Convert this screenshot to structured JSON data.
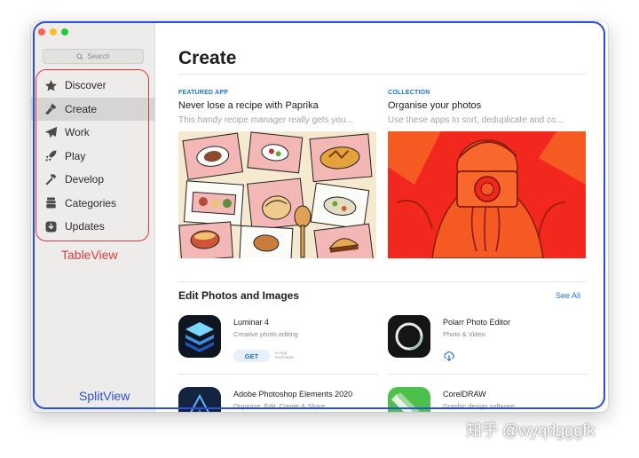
{
  "sidebar": {
    "search_placeholder": "Search",
    "items": [
      {
        "label": "Discover",
        "icon": "star-icon"
      },
      {
        "label": "Create",
        "icon": "brush-icon"
      },
      {
        "label": "Work",
        "icon": "paper-plane-icon"
      },
      {
        "label": "Play",
        "icon": "rocket-icon"
      },
      {
        "label": "Develop",
        "icon": "hammer-icon"
      },
      {
        "label": "Categories",
        "icon": "stack-icon"
      },
      {
        "label": "Updates",
        "icon": "download-icon"
      }
    ],
    "active": "Create"
  },
  "main": {
    "title": "Create",
    "features": [
      {
        "kicker": "FEATURED APP",
        "headline": "Never lose a recipe with Paprika",
        "sub": "This handy recipe manager really gets you..."
      },
      {
        "kicker": "COLLECTION",
        "headline": "Organise your photos",
        "sub": "Use these apps to sort, deduplicate and co..."
      }
    ],
    "section": {
      "title": "Edit Photos and Images",
      "see_all": "See All"
    },
    "apps": [
      {
        "name": "Luminar 4",
        "category": "Creative photo editing",
        "action": "GET",
        "note": "In-App Purchases"
      },
      {
        "name": "Polarr Photo Editor",
        "category": "Photo & Video",
        "action": "download"
      },
      {
        "name": "Adobe Photoshop Elements 2020",
        "category": "Organize, Edit, Create & Share"
      },
      {
        "name": "CorelDRAW",
        "category": "Graphic design software"
      }
    ]
  },
  "annotations": {
    "table_view": "TableView",
    "split_view": "SplitView"
  },
  "watermark": "知乎 @wyqdgggfk",
  "colors": {
    "accent": "#1a73d9",
    "annotation_red": "#e0393e",
    "annotation_blue": "#2b4fd9",
    "sidebar_bg": "#edeceb"
  }
}
